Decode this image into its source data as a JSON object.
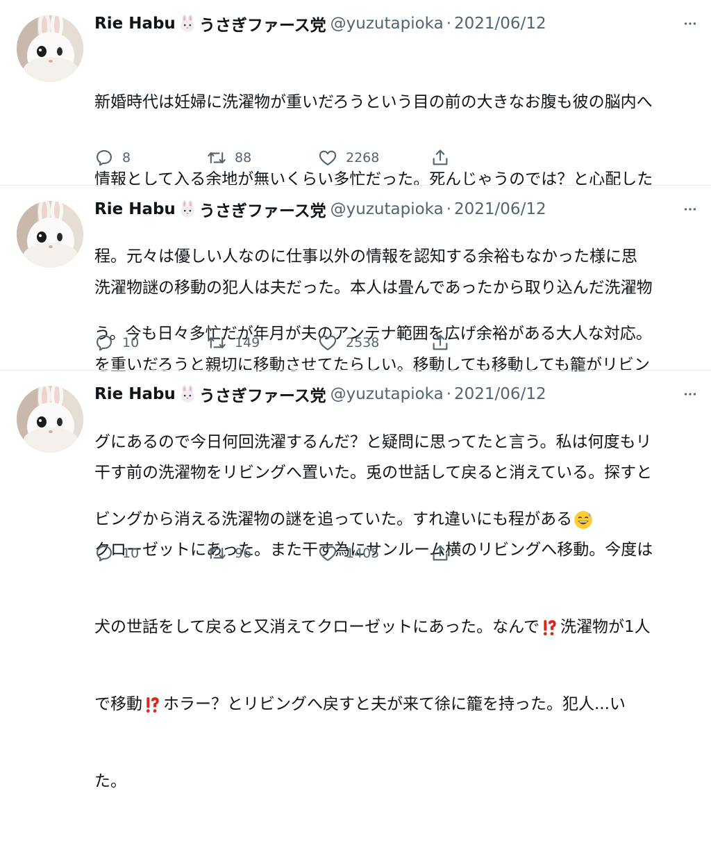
{
  "tweets": [
    {
      "name": "Rie Habu",
      "name_suffix": "うさぎファース党",
      "handle": "@yuzutapioka",
      "separator": "·",
      "date": "2021/06/12",
      "lines": [
        "新婚時代は妊婦に洗濯物が重いだろうという目の前の大きなお腹も彼の脳内へ",
        "情報として入る余地が無いくらい多忙だった。死んじゃうのでは？と心配した",
        "程。元々は優しい人なのに仕事以外の情報を認知する余裕もなかった様に思",
        "う。今も日々多忙だが年月が夫のアンテナ範囲を広げ余裕がある大人な対応。"
      ],
      "replies": "8",
      "retweets": "88",
      "likes": "2268"
    },
    {
      "name": "Rie Habu",
      "name_suffix": "うさぎファース党",
      "handle": "@yuzutapioka",
      "separator": "·",
      "date": "2021/06/12",
      "lines": [
        "洗濯物謎の移動の犯人は夫だった。本人は畳んであったから取り込んだ洗濯物",
        "を重いだろうと親切に移動させてたらしい。移動しても移動しても籠がリビン",
        "グにあるので今日何回洗濯するんだ？と疑問に思ってたと言う。私は何度もリ",
        "ビングから消える洗濯物の謎を追っていた。すれ違いにも程がある"
      ],
      "replies": "10",
      "retweets": "149",
      "likes": "2538"
    },
    {
      "name": "Rie Habu",
      "name_suffix": "うさぎファース党",
      "handle": "@yuzutapioka",
      "separator": "·",
      "date": "2021/06/12",
      "lines": [
        "干す前の洗濯物をリビングへ置いた。兎の世話して戻ると消えている。探すと",
        "クローゼットにあった。また干す為にサンルーム横のリビングへ移動。今度は",
        "犬の世話をして戻ると又消えてクローゼットにあった。なんで",
        "で移動",
        "た。"
      ],
      "line3_after": "洗濯物が1人",
      "line4_after": "ホラー？とリビングへ戻すと夫が来て徐に籠を持った。犯人...い",
      "replies": "10",
      "retweets": "96",
      "likes": "1405"
    }
  ],
  "icons": {
    "avatar": "rabbit-avatar",
    "name_emoji": "rabbit-face-emoji",
    "more": "more-dots-icon",
    "reply": "reply-icon",
    "retweet": "retweet-icon",
    "like": "heart-icon",
    "share": "share-icon",
    "sweat_smile": "grinning-sweat-emoji",
    "interrobang": "exclamation-question-emoji"
  },
  "colors": {
    "secondary_text": "#536471",
    "interrobang": "#e0261b"
  }
}
